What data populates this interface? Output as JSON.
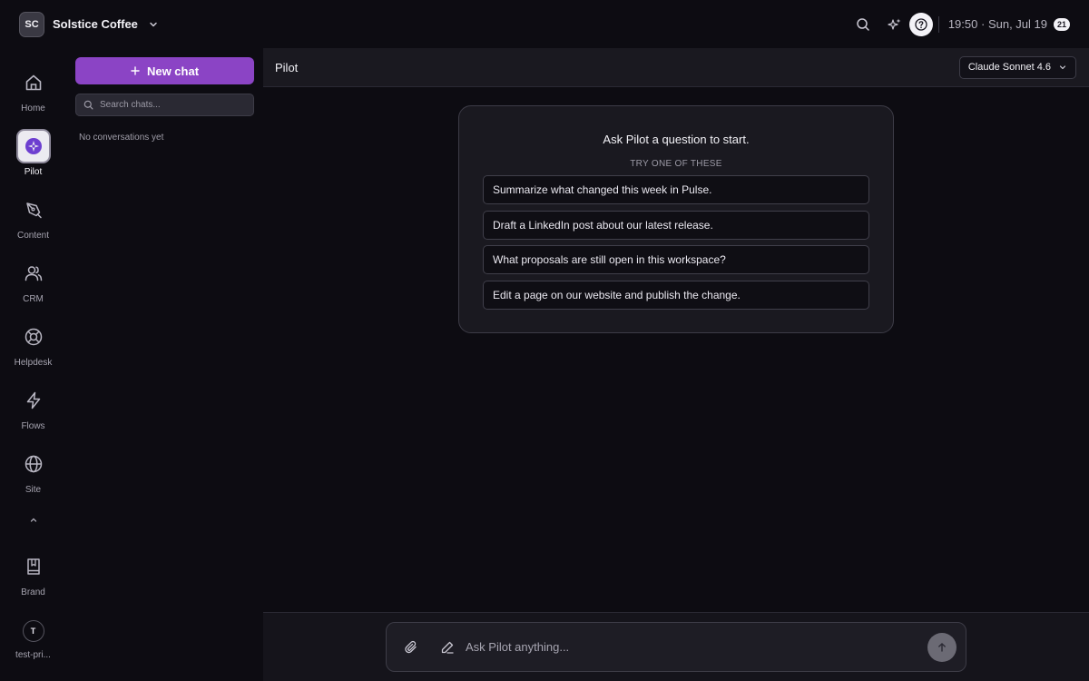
{
  "workspace": {
    "initials": "SC",
    "name": "Solstice Coffee"
  },
  "topbar": {
    "time": "19:50",
    "separator": "·",
    "date": "Sun, Jul 19",
    "notification_count": "21"
  },
  "rail": {
    "items": [
      {
        "label": "Home",
        "icon": "home-icon"
      },
      {
        "label": "Pilot",
        "icon": "pilot-icon",
        "active": true
      },
      {
        "label": "Content",
        "icon": "pen-nib-icon"
      },
      {
        "label": "CRM",
        "icon": "users-icon"
      },
      {
        "label": "Helpdesk",
        "icon": "lifebuoy-icon"
      },
      {
        "label": "Flows",
        "icon": "lightning-icon"
      },
      {
        "label": "Site",
        "icon": "globe-icon"
      }
    ],
    "brand_label": "Brand",
    "user_initial": "T",
    "user_label": "test-pri..."
  },
  "chatpanel": {
    "new_chat_label": "New chat",
    "search_placeholder": "Search chats...",
    "empty_text": "No conversations yet"
  },
  "main": {
    "title": "Pilot",
    "model": "Claude Sonnet 4.6",
    "card_title": "Ask Pilot a question to start.",
    "card_subtitle": "TRY ONE OF THESE",
    "suggestions": [
      "Summarize what changed this week in Pulse.",
      "Draft a LinkedIn post about our latest release.",
      "What proposals are still open in this workspace?",
      "Edit a page on our website and publish the change."
    ],
    "composer_placeholder": "Ask Pilot anything..."
  },
  "colors": {
    "accent": "#8b44c5",
    "background": "#0d0c12",
    "panel": "#1a1920"
  }
}
